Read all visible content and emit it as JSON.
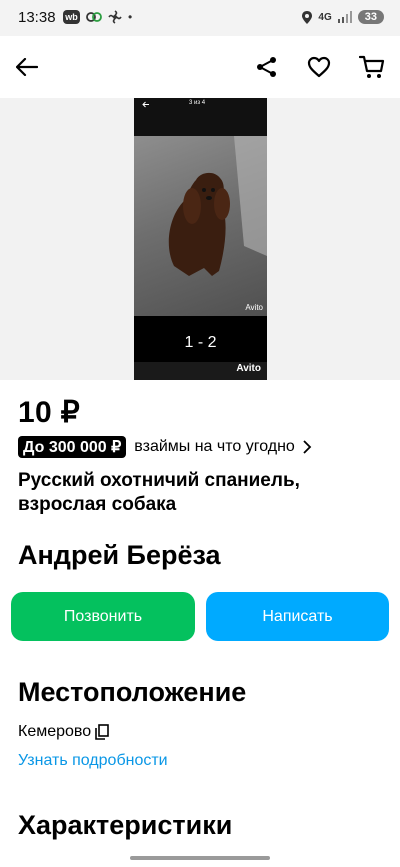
{
  "status_bar": {
    "time": "13:38",
    "wb_badge": "wb",
    "dot": "•",
    "network": "4G",
    "battery": "33"
  },
  "screenshot_overlay": {
    "page_indicator": "3 из 4",
    "counter": "1 - 2",
    "watermark": "Avito",
    "watermark_photo": "Avito"
  },
  "listing": {
    "price": "10 ₽",
    "loan_badge": "До 300 000 ₽",
    "loan_text": "взаймы на что угодно",
    "title": "Русский охотничий спаниель, взрослая собака"
  },
  "seller": {
    "name": "Андрей Берёза",
    "call_label": "Позвонить",
    "write_label": "Написать"
  },
  "location": {
    "heading": "Местоположение",
    "city": "Кемерово",
    "more_link": "Узнать подробности"
  },
  "characteristics": {
    "heading": "Характеристики"
  },
  "colors": {
    "call_button": "#04c15e",
    "write_button": "#00aaff",
    "link": "#0a97e6"
  }
}
